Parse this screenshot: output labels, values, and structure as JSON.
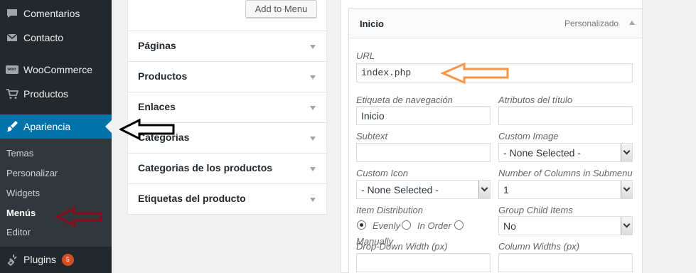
{
  "sidebar": {
    "items": [
      {
        "label": "Comentarios",
        "icon": "comment-icon"
      },
      {
        "label": "Contacto",
        "icon": "mail-icon"
      },
      {
        "label": "WooCommerce",
        "icon": "woocommerce-icon",
        "icon_text": "woo"
      },
      {
        "label": "Productos",
        "icon": "cart-icon"
      },
      {
        "label": "Apariencia",
        "icon": "brush-icon",
        "active": true
      },
      {
        "label": "Plugins",
        "icon": "plug-icon",
        "badge": "5"
      }
    ],
    "submenu": [
      {
        "label": "Temas"
      },
      {
        "label": "Personalizar"
      },
      {
        "label": "Widgets"
      },
      {
        "label": "Menús",
        "current": true
      },
      {
        "label": "Editor"
      }
    ]
  },
  "accordion": {
    "add_button": "Add to Menu",
    "sections": [
      {
        "label": "Páginas"
      },
      {
        "label": "Productos"
      },
      {
        "label": "Enlaces"
      },
      {
        "label": "Categorias"
      },
      {
        "label": "Categorias de los productos"
      },
      {
        "label": "Etiquetas del producto"
      }
    ]
  },
  "menu_item": {
    "title": "Inicio",
    "type": "Personalizado",
    "fields": {
      "url": {
        "label": "URL",
        "value": "index.php"
      },
      "nav_label": {
        "label": "Etiqueta de navegación",
        "value": "Inicio"
      },
      "title_attr": {
        "label": "Atributos del título",
        "value": ""
      },
      "subtext": {
        "label": "Subtext",
        "value": ""
      },
      "custom_image": {
        "label": "Custom Image",
        "value": "- None Selected -"
      },
      "custom_icon": {
        "label": "Custom Icon",
        "value": "- None Selected -"
      },
      "columns": {
        "label": "Number of Columns in Submenu",
        "value": "1"
      },
      "distribution": {
        "label": "Item Distribution",
        "options": [
          {
            "label": "Evenly",
            "checked": true
          },
          {
            "label": "In Order",
            "checked": false
          },
          {
            "label": "Manually",
            "checked": false
          }
        ]
      },
      "group_child": {
        "label": "Group Child Items",
        "value": "No"
      },
      "dropdown_width": {
        "label": "Drop-Down Width (px)",
        "value": ""
      },
      "column_widths": {
        "label": "Column Widths (px)",
        "value": ""
      }
    }
  },
  "colors": {
    "sidebar_bg": "#23282d",
    "active_bg": "#0073aa",
    "badge": "#d54e21",
    "annotation_orange": "#f79646",
    "annotation_red": "#8b0a1a",
    "annotation_black": "#000000"
  }
}
